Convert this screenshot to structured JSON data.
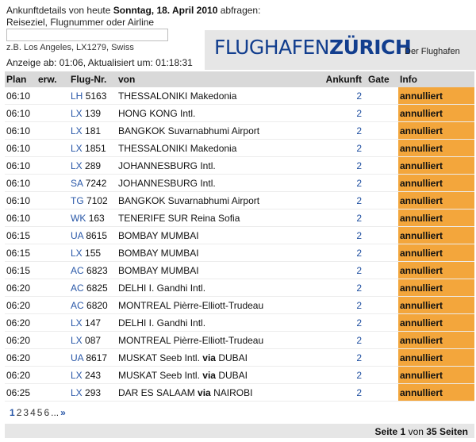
{
  "query": {
    "line1_prefix": "Ankunftdetails von heute",
    "date": "Sonntag, 18. April 2010",
    "line1_suffix": "abfragen:",
    "line2": "Reiseziel, Flugnummer oder Airline",
    "input_value": "",
    "hint": "z.B. Los Angeles, LX1279, Swiss",
    "updated": "Anzeige ab: 01:06, Aktualisiert um: 01:18:31"
  },
  "brand": {
    "logo_part1": "FLUGHAFEN",
    "logo_part2": "ZÜRICH",
    "tagline": "Der Flughafen"
  },
  "colors": {
    "accent": "#f3a63c",
    "link": "#2a58a8",
    "header_bg": "#d9d9d9",
    "logo_blue": "#123e8e"
  },
  "table": {
    "headers": {
      "plan": "Plan",
      "erw": "erw.",
      "flight": "Flug-Nr.",
      "from": "von",
      "arrival": "Ankunft",
      "gate": "Gate",
      "info": "Info"
    },
    "rows": [
      {
        "plan": "06:10",
        "erw": "",
        "airline": "LH",
        "number": "5163",
        "from": "THESSALONIKI Makedonia",
        "via": "",
        "via_to": "",
        "arrival": "2",
        "gate": "",
        "info": "annulliert"
      },
      {
        "plan": "06:10",
        "erw": "",
        "airline": "LX",
        "number": "139",
        "from": "HONG KONG Intl.",
        "via": "",
        "via_to": "",
        "arrival": "2",
        "gate": "",
        "info": "annulliert"
      },
      {
        "plan": "06:10",
        "erw": "",
        "airline": "LX",
        "number": "181",
        "from": "BANGKOK Suvarnabhumi Airport",
        "via": "",
        "via_to": "",
        "arrival": "2",
        "gate": "",
        "info": "annulliert"
      },
      {
        "plan": "06:10",
        "erw": "",
        "airline": "LX",
        "number": "1851",
        "from": "THESSALONIKI Makedonia",
        "via": "",
        "via_to": "",
        "arrival": "2",
        "gate": "",
        "info": "annulliert"
      },
      {
        "plan": "06:10",
        "erw": "",
        "airline": "LX",
        "number": "289",
        "from": "JOHANNESBURG Intl.",
        "via": "",
        "via_to": "",
        "arrival": "2",
        "gate": "",
        "info": "annulliert"
      },
      {
        "plan": "06:10",
        "erw": "",
        "airline": "SA",
        "number": "7242",
        "from": "JOHANNESBURG Intl.",
        "via": "",
        "via_to": "",
        "arrival": "2",
        "gate": "",
        "info": "annulliert"
      },
      {
        "plan": "06:10",
        "erw": "",
        "airline": "TG",
        "number": "7102",
        "from": "BANGKOK Suvarnabhumi Airport",
        "via": "",
        "via_to": "",
        "arrival": "2",
        "gate": "",
        "info": "annulliert"
      },
      {
        "plan": "06:10",
        "erw": "",
        "airline": "WK",
        "number": "163",
        "from": "TENERIFE SUR Reina Sofia",
        "via": "",
        "via_to": "",
        "arrival": "2",
        "gate": "",
        "info": "annulliert"
      },
      {
        "plan": "06:15",
        "erw": "",
        "airline": "UA",
        "number": "8615",
        "from": "BOMBAY MUMBAI",
        "via": "",
        "via_to": "",
        "arrival": "2",
        "gate": "",
        "info": "annulliert"
      },
      {
        "plan": "06:15",
        "erw": "",
        "airline": "LX",
        "number": "155",
        "from": "BOMBAY MUMBAI",
        "via": "",
        "via_to": "",
        "arrival": "2",
        "gate": "",
        "info": "annulliert"
      },
      {
        "plan": "06:15",
        "erw": "",
        "airline": "AC",
        "number": "6823",
        "from": "BOMBAY MUMBAI",
        "via": "",
        "via_to": "",
        "arrival": "2",
        "gate": "",
        "info": "annulliert"
      },
      {
        "plan": "06:20",
        "erw": "",
        "airline": "AC",
        "number": "6825",
        "from": "DELHI I. Gandhi Intl.",
        "via": "",
        "via_to": "",
        "arrival": "2",
        "gate": "",
        "info": "annulliert"
      },
      {
        "plan": "06:20",
        "erw": "",
        "airline": "AC",
        "number": "6820",
        "from": "MONTREAL Pièrre-Elliott-Trudeau",
        "via": "",
        "via_to": "",
        "arrival": "2",
        "gate": "",
        "info": "annulliert"
      },
      {
        "plan": "06:20",
        "erw": "",
        "airline": "LX",
        "number": "147",
        "from": "DELHI I. Gandhi Intl.",
        "via": "",
        "via_to": "",
        "arrival": "2",
        "gate": "",
        "info": "annulliert"
      },
      {
        "plan": "06:20",
        "erw": "",
        "airline": "LX",
        "number": "087",
        "from": "MONTREAL Pièrre-Elliott-Trudeau",
        "via": "",
        "via_to": "",
        "arrival": "2",
        "gate": "",
        "info": "annulliert"
      },
      {
        "plan": "06:20",
        "erw": "",
        "airline": "UA",
        "number": "8617",
        "from": "MUSKAT Seeb Intl.",
        "via": "via",
        "via_to": "DUBAI",
        "arrival": "2",
        "gate": "",
        "info": "annulliert"
      },
      {
        "plan": "06:20",
        "erw": "",
        "airline": "LX",
        "number": "243",
        "from": "MUSKAT Seeb Intl.",
        "via": "via",
        "via_to": "DUBAI",
        "arrival": "2",
        "gate": "",
        "info": "annulliert"
      },
      {
        "plan": "06:25",
        "erw": "",
        "airline": "LX",
        "number": "293",
        "from": "DAR ES SALAAM",
        "via": "via",
        "via_to": "NAIROBI",
        "arrival": "2",
        "gate": "",
        "info": "annulliert"
      }
    ]
  },
  "pagination": {
    "pages": [
      "1",
      "2",
      "3",
      "4",
      "5",
      "6"
    ],
    "ellipsis": "...",
    "next": "»",
    "summary_prefix": "Seite",
    "current": "1",
    "summary_mid": "von",
    "total": "35",
    "summary_suffix": "Seiten"
  }
}
